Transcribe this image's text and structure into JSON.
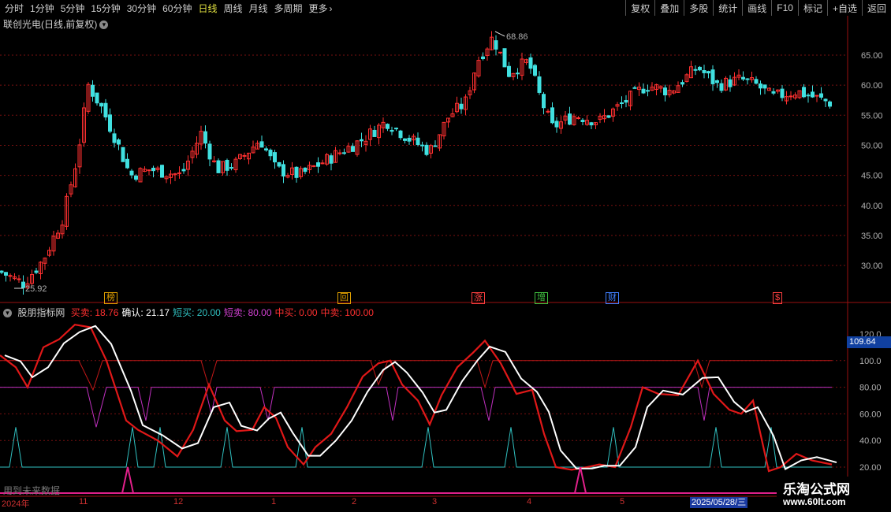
{
  "toolbar": {
    "periods": [
      "分时",
      "1分钟",
      "5分钟",
      "15分钟",
      "30分钟",
      "60分钟",
      "日线",
      "周线",
      "月线",
      "多周期",
      "更多"
    ],
    "active_period": "日线",
    "right_buttons": [
      "复权",
      "叠加",
      "多股",
      "统计",
      "画线",
      "F10",
      "标记",
      "+自选",
      "返回"
    ]
  },
  "stock": {
    "name": "联创光电",
    "mode": "(日线,前复权)"
  },
  "price_axis": {
    "labels": [
      "65.00",
      "60.00",
      "55.00",
      "50.00",
      "45.00",
      "40.00",
      "35.00",
      "30.00"
    ],
    "high_label": "68.86",
    "low_label": "25.92"
  },
  "event_markers": [
    {
      "label": "榜",
      "color": "#e0a000"
    },
    {
      "label": "回",
      "color": "#e0a000"
    },
    {
      "label": "涨",
      "color": "#ff4040"
    },
    {
      "label": "增",
      "color": "#40c040"
    },
    {
      "label": "财",
      "color": "#4080ff"
    },
    {
      "label": "$",
      "color": "#ff4040"
    }
  ],
  "indicator": {
    "name": "股朋指标网",
    "items": [
      {
        "label": "买卖:",
        "value": "18.76",
        "color": "#ff3030"
      },
      {
        "label": "确认:",
        "value": "21.17",
        "color": "#ffffff"
      },
      {
        "label": "短买:",
        "value": "20.00",
        "color": "#30c0c0"
      },
      {
        "label": "短卖:",
        "value": "80.00",
        "color": "#d040d0"
      },
      {
        "label": "中买:",
        "value": "0.00",
        "color": "#ff3030"
      },
      {
        "label": "中卖:",
        "value": "100.00",
        "color": "#ff3030"
      }
    ],
    "axis_labels": [
      "120.0",
      "100.0",
      "80.00",
      "60.00",
      "40.00",
      "20.00"
    ],
    "current_badge": "109.64",
    "future_note": "用到未来数据"
  },
  "time_axis": {
    "labels": [
      "2024年",
      "11",
      "12",
      "1",
      "2",
      "3",
      "4",
      "5"
    ],
    "cursor_date": "2025/05/28/三"
  },
  "watermark": {
    "title": "乐淘公式网",
    "url": "www.60lt.com"
  },
  "colors": {
    "up": "#ff3030",
    "down": "#40e0e0",
    "grid": "#7a1010"
  }
}
